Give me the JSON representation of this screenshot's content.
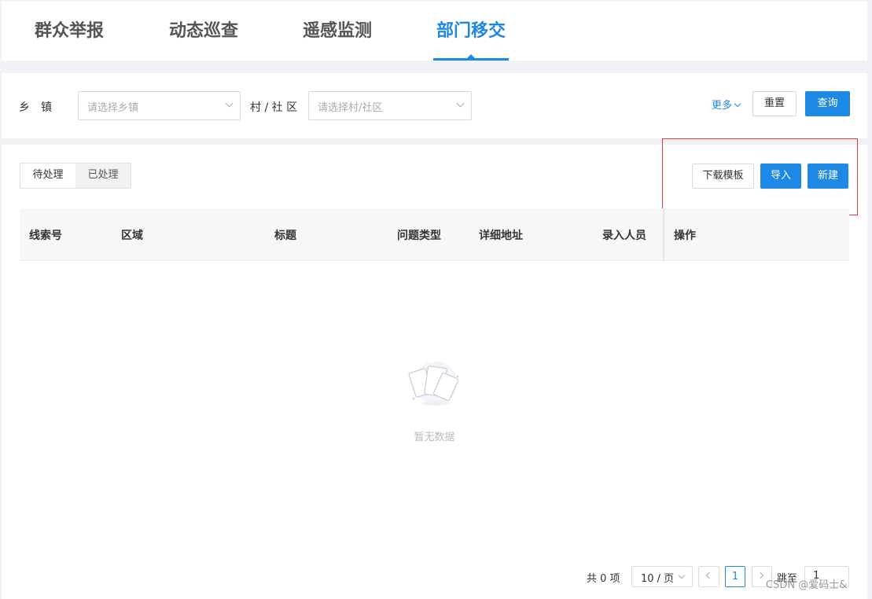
{
  "tabs": [
    {
      "label": "群众举报",
      "active": false
    },
    {
      "label": "动态巡查",
      "active": false
    },
    {
      "label": "遥感监测",
      "active": false
    },
    {
      "label": "部门移交",
      "active": true
    }
  ],
  "filter": {
    "town_label": "乡　镇",
    "town_placeholder": "请选择乡镇",
    "village_label": "村 / 社 区",
    "village_placeholder": "请选择村/社区",
    "more_label": "更多",
    "reset_label": "重置",
    "query_label": "查询"
  },
  "toolbar": {
    "pending_label": "待处理",
    "processed_label": "已处理",
    "download_template_label": "下载模板",
    "import_label": "导入",
    "create_label": "新建"
  },
  "table": {
    "columns": [
      "线索号",
      "区域",
      "标题",
      "问题类型",
      "详细地址",
      "录入人员",
      "操作"
    ],
    "rows": [],
    "empty_text": "暂无数据"
  },
  "pagination": {
    "total_text": "共 0 项",
    "page_size": "10 / 页",
    "current_page": "1",
    "jump_label": "跳至",
    "jump_value": "1"
  },
  "watermark": "CSDN @爱码士&",
  "colors": {
    "accent": "#1e88e5",
    "highlight_box": "#e53935"
  }
}
